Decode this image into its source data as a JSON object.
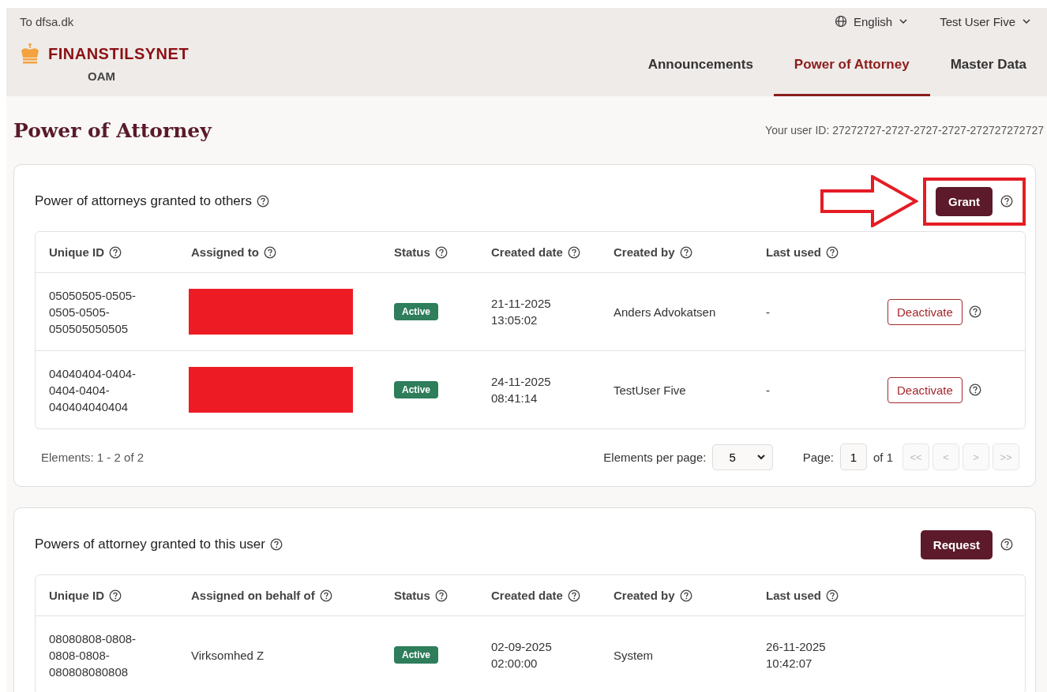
{
  "top_bar": {
    "back_link": "To dfsa.dk",
    "language": "English",
    "user": "Test User Five"
  },
  "logo": {
    "name": "FINANSTILSYNET",
    "subtitle": "OAM"
  },
  "nav": [
    {
      "label": "Announcements",
      "selected": false
    },
    {
      "label": "Power of Attorney",
      "selected": true
    },
    {
      "label": "Master Data",
      "selected": false
    }
  ],
  "page_title": "Power of Attorney",
  "user_id": "Your user ID: 27272727-2727-2727-2727-272727272727",
  "sections": [
    {
      "title": "Power of attorneys granted to others",
      "action": {
        "label": "Grant",
        "highlighted": true
      },
      "columns": [
        "Unique ID",
        "Assigned to",
        "Status",
        "Created date",
        "Created by",
        "Last used"
      ],
      "rows": [
        {
          "cells": [
            {
              "kind": "text",
              "text": "05050505-0505-0505-0505-050505050505"
            },
            {
              "kind": "redacted"
            },
            {
              "kind": "status",
              "text": "Active"
            },
            {
              "kind": "text",
              "text": "21-11-2025 13:05:02"
            },
            {
              "kind": "text",
              "text": "Anders Advokatsen"
            },
            {
              "kind": "text",
              "text": "-"
            }
          ],
          "action": "Deactivate"
        },
        {
          "cells": [
            {
              "kind": "text",
              "text": "04040404-0404-0404-0404-040404040404"
            },
            {
              "kind": "redacted"
            },
            {
              "kind": "status",
              "text": "Active"
            },
            {
              "kind": "text",
              "text": "24-11-2025 08:41:14"
            },
            {
              "kind": "text",
              "text": "TestUser Five"
            },
            {
              "kind": "text",
              "text": "-"
            }
          ],
          "action": "Deactivate"
        }
      ],
      "footer": {
        "count": "Elements: 1 - 2 of 2",
        "per_page_label": "Elements per page:",
        "per_page": "5",
        "page_label": "Page:",
        "page": "1",
        "page_total": "of 1",
        "pager": [
          {
            "label": "<<",
            "disabled": true
          },
          {
            "label": "<",
            "disabled": true
          },
          {
            "label": ">",
            "disabled": true
          },
          {
            "label": ">>",
            "disabled": true
          }
        ]
      }
    },
    {
      "title": "Powers of attorney granted to this user",
      "action": {
        "label": "Request",
        "highlighted": false
      },
      "columns": [
        "Unique ID",
        "Assigned on behalf of",
        "Status",
        "Created date",
        "Created by",
        "Last used"
      ],
      "rows": [
        {
          "cells": [
            {
              "kind": "text",
              "text": "08080808-0808-0808-0808-080808080808"
            },
            {
              "kind": "text",
              "text": "Virksomhed Z"
            },
            {
              "kind": "status",
              "text": "Active"
            },
            {
              "kind": "text",
              "text": "02-09-2025 02:00:00"
            },
            {
              "kind": "text",
              "text": "System"
            },
            {
              "kind": "text",
              "text": "26-11-2025 10:42:07"
            }
          ]
        }
      ]
    }
  ]
}
